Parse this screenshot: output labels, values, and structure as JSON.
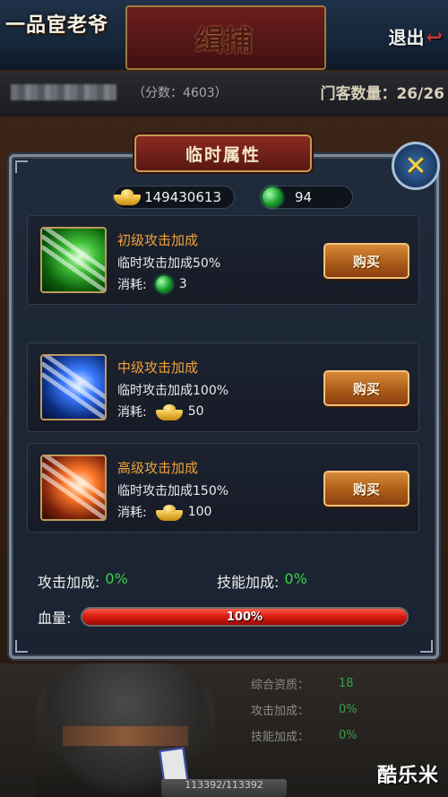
{
  "app": {
    "logo": "一品宦老爷",
    "page_title": "缉捕",
    "exit_label": "退出",
    "score_text": "（分数：4603）",
    "guest_count_text": "门客数量：26/26"
  },
  "background_stats": {
    "rows": [
      {
        "label": "综合资质：",
        "value": "18"
      },
      {
        "label": "攻击加成：",
        "value": "0%"
      },
      {
        "label": "技能加成：",
        "value": "0%"
      }
    ],
    "hp_text": "113392/113392"
  },
  "watermark": "酷乐米",
  "modal": {
    "title": "临时属性",
    "close_icon": "close-x-icon",
    "currency": {
      "gold": "149430613",
      "jade": "94"
    },
    "items": [
      {
        "name": "初级攻击加成",
        "desc": "临时攻击加成50%",
        "cost_label": "消耗:",
        "cost_value": "3",
        "cost_icon": "jade-gem-icon",
        "buy_label": "购买",
        "color": "#42c23a"
      },
      {
        "name": "中级攻击加成",
        "desc": "临时攻击加成100%",
        "cost_label": "消耗:",
        "cost_value": "50",
        "cost_icon": "gold-ingot-icon",
        "buy_label": "购买",
        "color": "#3a7aff"
      },
      {
        "name": "高级攻击加成",
        "desc": "临时攻击加成150%",
        "cost_label": "消耗:",
        "cost_value": "100",
        "cost_icon": "gold-ingot-icon",
        "buy_label": "购买",
        "color": "#ff7a2a"
      }
    ],
    "attack_bonus_label": "攻击加成:",
    "attack_bonus_value": "0%",
    "skill_bonus_label": "技能加成:",
    "skill_bonus_value": "0%",
    "hp_label": "血量:",
    "hp_value_text": "100%",
    "hp_fraction": 1.0
  },
  "colors": {
    "accent_orange": "#f0a23a",
    "bonus_green": "#3ad24a",
    "hp_red": "#d81a10"
  }
}
